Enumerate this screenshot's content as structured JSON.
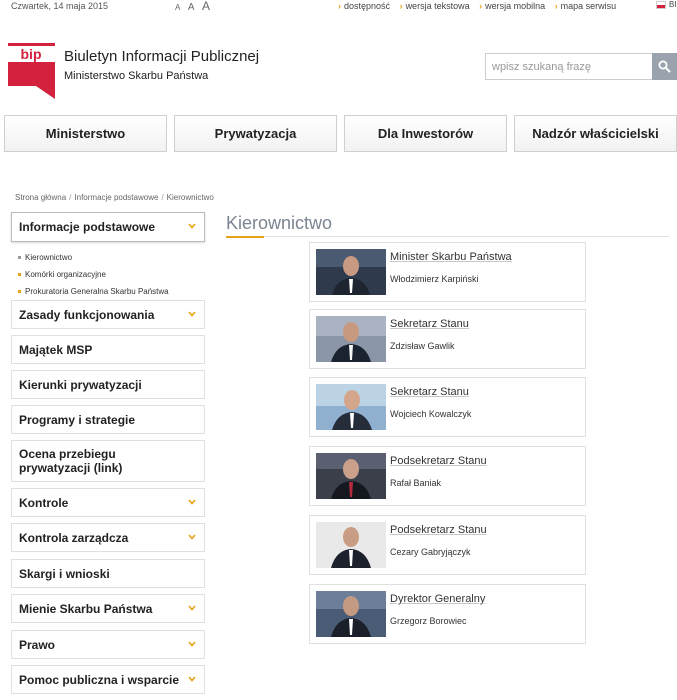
{
  "topbar": {
    "date": "Czwartek, 14 maja 2015",
    "font_sizes": [
      "A",
      "A",
      "A"
    ],
    "links": [
      "dostępność",
      "wersja tekstowa",
      "wersja mobilna",
      "mapa serwisu"
    ],
    "lang_label": "BI"
  },
  "header": {
    "logo_text": "bip",
    "title": "Biuletyn Informacji  Publicznej",
    "subtitle": "Ministerstwo Skarbu Państwa",
    "search_placeholder": "wpisz szukaną frazę"
  },
  "nav": [
    "Ministerstwo",
    "Prywatyzacja",
    "Dla Inwestorów",
    "Nadzór właścicielski"
  ],
  "breadcrumb": [
    "Strona główna",
    "Informacje podstawowe",
    "Kierownictwo"
  ],
  "sidebar": {
    "active": "Informacje podstawowe",
    "subitems": [
      "Kierownictwo",
      "Komórki organizacyjne",
      "Prokuratoria Generalna Skarbu Państwa"
    ],
    "items": [
      {
        "label": "Zasady funkcjonowania",
        "chevron": true
      },
      {
        "label": "Majątek MSP",
        "chevron": false
      },
      {
        "label": "Kierunki prywatyzacji",
        "chevron": false
      },
      {
        "label": "Programy i strategie",
        "chevron": false
      },
      {
        "label": "Ocena przebiegu prywatyzacji (link)",
        "chevron": false
      },
      {
        "label": "Kontrole",
        "chevron": true
      },
      {
        "label": "Kontrola zarządcza",
        "chevron": true
      },
      {
        "label": "Skargi i wnioski",
        "chevron": false
      },
      {
        "label": "Mienie Skarbu Państwa",
        "chevron": true
      },
      {
        "label": "Prawo",
        "chevron": true
      },
      {
        "label": "Pomoc publiczna i wsparcie",
        "chevron": true
      }
    ]
  },
  "content": {
    "title": "Kierownictwo",
    "people": [
      {
        "role": "Minister Skarbu Państwa",
        "name": "Włodzimierz Karpiński"
      },
      {
        "role": "Sekretarz Stanu",
        "name": "Zdzisław Gawlik"
      },
      {
        "role": "Sekretarz Stanu",
        "name": "Wojciech Kowalczyk"
      },
      {
        "role": "Podsekretarz Stanu",
        "name": "Rafał Baniak"
      },
      {
        "role": "Podsekretarz Stanu",
        "name": "Cezary Gabryjączyk"
      },
      {
        "role": "Dyrektor Generalny",
        "name": "Grzegorz Borowiec"
      }
    ]
  },
  "colors": {
    "accent": "#e8a317",
    "logo_red": "#d4213d",
    "title_grey": "#7a8591"
  }
}
